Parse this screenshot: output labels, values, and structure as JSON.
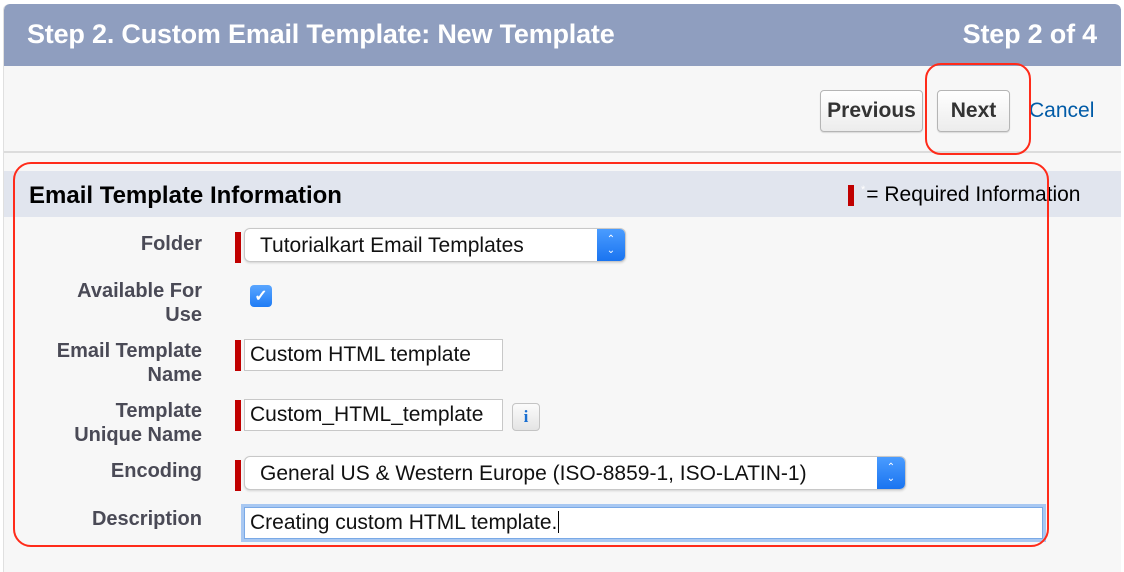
{
  "header": {
    "title": "Step 2. Custom Email Template: New Template",
    "step_indicator": "Step 2 of 4"
  },
  "toolbar": {
    "previous_label": "Previous",
    "next_label": "Next",
    "cancel_label": "Cancel"
  },
  "section": {
    "title": "Email Template Information",
    "required_legend": "= Required Information",
    "required_star": "*"
  },
  "form": {
    "folder": {
      "label": "Folder",
      "value": "Tutorialkart Email Templates",
      "required": true
    },
    "available_for_use": {
      "label_line1": "Available For",
      "label_line2": "Use",
      "checked": true,
      "check_glyph": "✓"
    },
    "template_name": {
      "label_line1": "Email Template",
      "label_line2": "Name",
      "value": "Custom HTML template",
      "required": true
    },
    "unique_name": {
      "label_line1": "Template",
      "label_line2": "Unique Name",
      "value": "Custom_HTML_template",
      "required": true,
      "info_glyph": "i"
    },
    "encoding": {
      "label": "Encoding",
      "value": "General US & Western Europe (ISO-8859-1, ISO-LATIN-1)",
      "required": true
    },
    "description": {
      "label": "Description",
      "value": "Creating custom HTML template."
    }
  },
  "icons": {
    "select_up": "⌃",
    "select_down": "⌄"
  },
  "colors": {
    "header_bg": "#8f9ebf",
    "section_bg": "#e1e5ee",
    "required_red": "#c00000",
    "link_blue": "#015ba7",
    "annotation_red": "#ff2b1a",
    "select_blue": "#1a74f0"
  }
}
